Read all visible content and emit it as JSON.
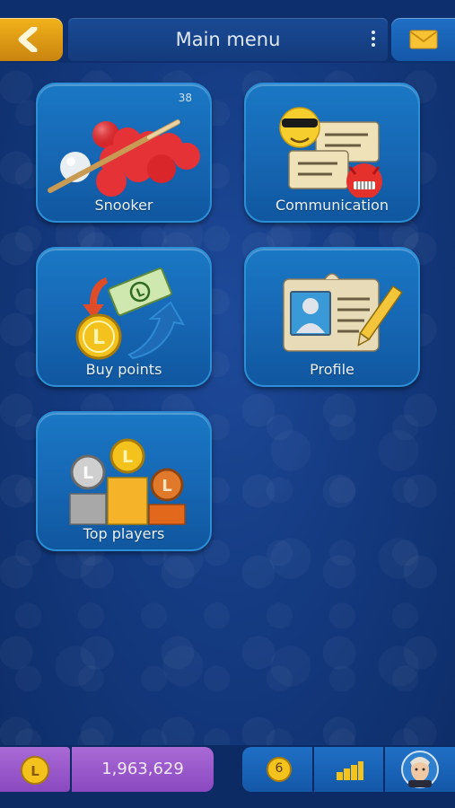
{
  "header": {
    "title": "Main menu"
  },
  "tiles": {
    "snooker": {
      "label": "Snooker",
      "badge": "38"
    },
    "communication": {
      "label": "Communication"
    },
    "buy_points": {
      "label": "Buy points"
    },
    "profile": {
      "label": "Profile"
    },
    "top_players": {
      "label": "Top players"
    }
  },
  "footer": {
    "points": "1,963,629",
    "notifications": "6"
  },
  "colors": {
    "accent": "#f2b21a",
    "tile": "#1a78c4",
    "purple": "#9a58c9",
    "background": "#143a80"
  },
  "icons": [
    "back-arrow-icon",
    "menu-dots-icon",
    "mail-icon",
    "snooker-icon",
    "communication-icon",
    "buy-points-icon",
    "profile-icon",
    "top-players-icon",
    "coin-icon",
    "notification-icon",
    "stats-icon",
    "avatar"
  ]
}
